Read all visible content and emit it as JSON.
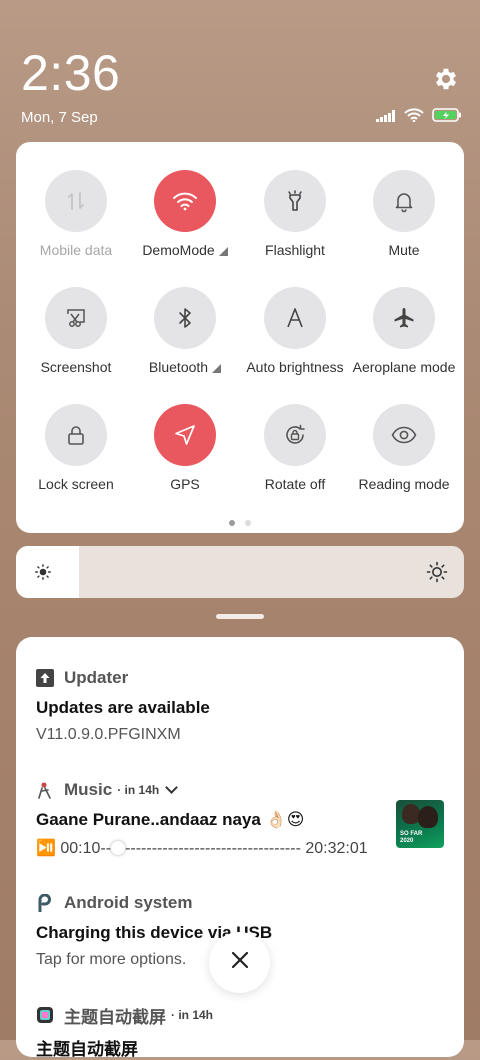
{
  "status": {
    "time": "2:36",
    "date": "Mon, 7 Sep",
    "icons": [
      "signal-icon",
      "wifi-icon",
      "battery-charging-icon"
    ]
  },
  "quick_settings": {
    "tiles": [
      {
        "label": "Mobile data",
        "icon": "mobile-data-icon",
        "active": false,
        "disabled": true
      },
      {
        "label": "DemoMode",
        "icon": "wifi-icon",
        "active": true,
        "expandable": true
      },
      {
        "label": "Flashlight",
        "icon": "flashlight-icon",
        "active": false
      },
      {
        "label": "Mute",
        "icon": "bell-icon",
        "active": false
      },
      {
        "label": "Screenshot",
        "icon": "screenshot-icon",
        "active": false
      },
      {
        "label": "Bluetooth",
        "icon": "bluetooth-icon",
        "active": false,
        "expandable": true
      },
      {
        "label": "Auto brightness",
        "icon": "auto-brightness-icon",
        "active": false
      },
      {
        "label": "Aeroplane mode",
        "icon": "airplane-icon",
        "active": false
      },
      {
        "label": "Lock screen",
        "icon": "lock-icon",
        "active": false
      },
      {
        "label": "GPS",
        "icon": "location-icon",
        "active": true
      },
      {
        "label": "Rotate off",
        "icon": "rotate-lock-icon",
        "active": false
      },
      {
        "label": "Reading mode",
        "icon": "eye-icon",
        "active": false
      }
    ],
    "page_count": 2,
    "current_page": 1
  },
  "brightness": {
    "level": 0.14
  },
  "notifications": [
    {
      "app": "Updater",
      "icon": "upload-icon",
      "title": "Updates are available",
      "text": "V11.0.9.0.PFGINXM"
    },
    {
      "app": "Music",
      "time": "· in 14h",
      "icon": "music-icon",
      "title": "Gaane Purane..andaaz naya 👌🏻😍",
      "player": {
        "current": "⏯️ 00:10--",
        "track": "---------------------------------",
        "end": " 20:32:01"
      },
      "thumb_text": "SO FAR 2020"
    },
    {
      "app": "Android system",
      "icon": "android-p-icon",
      "title": "Charging this device via USB",
      "text": "Tap for more options."
    },
    {
      "app": "主题自动截屏",
      "time": "· in 14h",
      "icon": "theme-screenshot-icon",
      "title": "主题自动截屏"
    }
  ],
  "colors": {
    "accent": "#e8585e",
    "tile_bg": "#e4e4e6"
  }
}
